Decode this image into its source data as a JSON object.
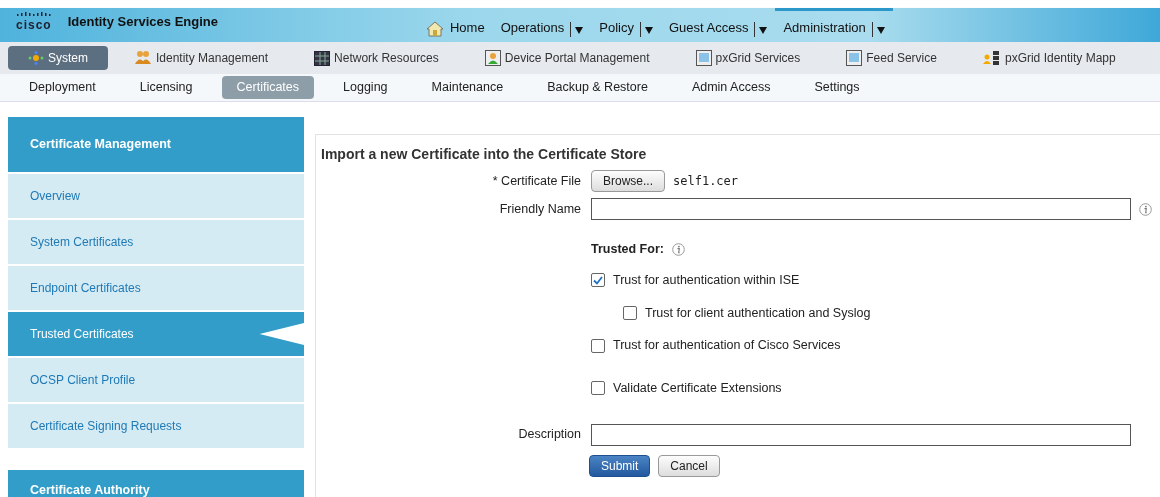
{
  "header": {
    "logo": "cisco",
    "product": "Identity Services Engine"
  },
  "top_menu": [
    {
      "label": "Home",
      "dropdown": false,
      "selected": false
    },
    {
      "label": "Operations",
      "dropdown": true,
      "selected": false
    },
    {
      "label": "Policy",
      "dropdown": true,
      "selected": false
    },
    {
      "label": "Guest Access",
      "dropdown": true,
      "selected": false
    },
    {
      "label": "Administration",
      "dropdown": true,
      "selected": true
    }
  ],
  "modules": [
    {
      "label": "System",
      "selected": true
    },
    {
      "label": "Identity Management",
      "selected": false
    },
    {
      "label": "Network Resources",
      "selected": false
    },
    {
      "label": "Device Portal Management",
      "selected": false
    },
    {
      "label": "pxGrid Services",
      "selected": false
    },
    {
      "label": "Feed Service",
      "selected": false
    },
    {
      "label": "pxGrid Identity Mapp",
      "selected": false
    }
  ],
  "subtabs": [
    {
      "label": "Deployment",
      "selected": false
    },
    {
      "label": "Licensing",
      "selected": false
    },
    {
      "label": "Certificates",
      "selected": true
    },
    {
      "label": "Logging",
      "selected": false
    },
    {
      "label": "Maintenance",
      "selected": false
    },
    {
      "label": "Backup & Restore",
      "selected": false
    },
    {
      "label": "Admin Access",
      "selected": false
    },
    {
      "label": "Settings",
      "selected": false
    }
  ],
  "sidebar": [
    {
      "title": "Certificate Management",
      "items": [
        {
          "label": "Overview",
          "selected": false
        },
        {
          "label": "System Certificates",
          "selected": false
        },
        {
          "label": "Endpoint Certificates",
          "selected": false
        },
        {
          "label": "Trusted Certificates",
          "selected": true
        },
        {
          "label": "OCSP Client Profile",
          "selected": false
        },
        {
          "label": "Certificate Signing Requests",
          "selected": false
        }
      ]
    },
    {
      "title": "Certificate Authority"
    }
  ],
  "form": {
    "title": "Import a new Certificate into the Certificate Store",
    "certificate_file": {
      "label": "* Certificate File",
      "button": "Browse...",
      "file": "self1.cer"
    },
    "friendly_name": {
      "label": "Friendly Name"
    },
    "trusted_for": {
      "label": "Trusted For:",
      "options": [
        {
          "label": "Trust for authentication within ISE",
          "checked": true,
          "children": [
            {
              "label": "Trust for client authentication and Syslog",
              "checked": false
            }
          ]
        },
        {
          "label": "Trust for authentication of Cisco Services",
          "checked": false
        }
      ]
    },
    "validate": {
      "label": "Validate Certificate Extensions",
      "checked": false
    },
    "description": {
      "label": "Description"
    },
    "buttons": [
      {
        "label": "Submit",
        "kind": "primary"
      },
      {
        "label": "Cancel",
        "kind": "secondary"
      }
    ]
  }
}
